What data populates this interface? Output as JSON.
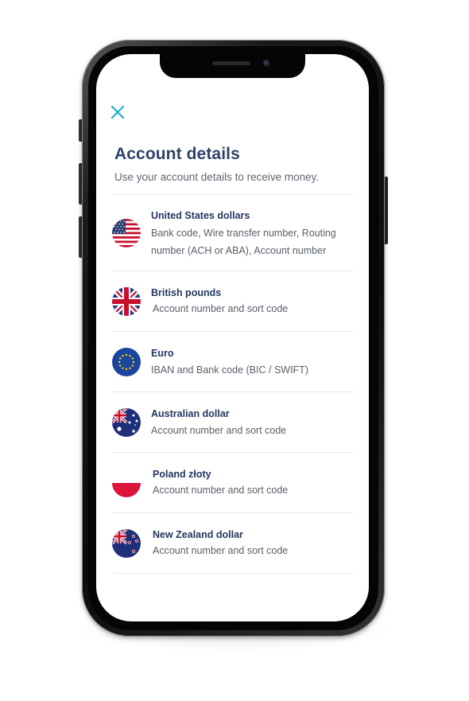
{
  "header": {
    "close_icon": "close-icon",
    "title": "Account details",
    "subtitle": "Use your account details to receive money."
  },
  "colors": {
    "accent": "#1ab0cf",
    "title": "#2e4369",
    "text": "#585f6a",
    "divider": "#e6e8ec"
  },
  "currencies": [
    {
      "flag": "us-flag-icon",
      "name": "United States dollars",
      "details": "Bank code, Wire transfer number, Routing number (ACH or ABA), Account number"
    },
    {
      "flag": "uk-flag-icon",
      "name": "British pounds",
      "details": "Account number and sort code"
    },
    {
      "flag": "eu-flag-icon",
      "name": "Euro",
      "details": "IBAN and Bank code (BIC / SWIFT)"
    },
    {
      "flag": "australia-flag-icon",
      "name": "Australian dollar",
      "details": "Account number and sort code"
    },
    {
      "flag": "poland-flag-icon",
      "name": "Poland złoty",
      "details": "Account number and sort code"
    },
    {
      "flag": "new-zealand-flag-icon",
      "name": "New Zealand dollar",
      "details": "Account number and sort code"
    }
  ]
}
